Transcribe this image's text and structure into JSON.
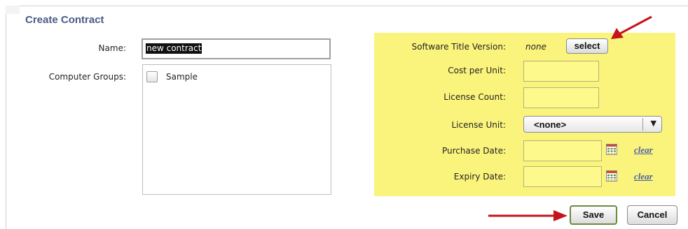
{
  "panel": {
    "title": "Create Contract"
  },
  "form": {
    "name_label": "Name:",
    "name_value": "new contract",
    "groups_label": "Computer Groups:",
    "groups": [
      {
        "label": "Sample",
        "checked": false
      }
    ]
  },
  "license": {
    "software_title_version_label": "Software Title Version:",
    "software_title_version_value": "none",
    "select_button": "select",
    "cost_per_unit_label": "Cost per Unit:",
    "cost_per_unit_value": "",
    "license_count_label": "License Count:",
    "license_count_value": "",
    "license_unit_label": "License Unit:",
    "license_unit_value": "<none>",
    "purchase_date_label": "Purchase Date:",
    "purchase_date_value": "",
    "expiry_date_label": "Expiry Date:",
    "expiry_date_value": "",
    "clear_link": "clear",
    "highlight_color": "#fbf47c"
  },
  "actions": {
    "save_label": "Save",
    "cancel_label": "Cancel"
  },
  "annotations": {
    "arrow_color": "#c4151c"
  },
  "icons": {
    "calendar": "calendar-icon",
    "dropdown_arrow": "chevron-down-icon"
  }
}
